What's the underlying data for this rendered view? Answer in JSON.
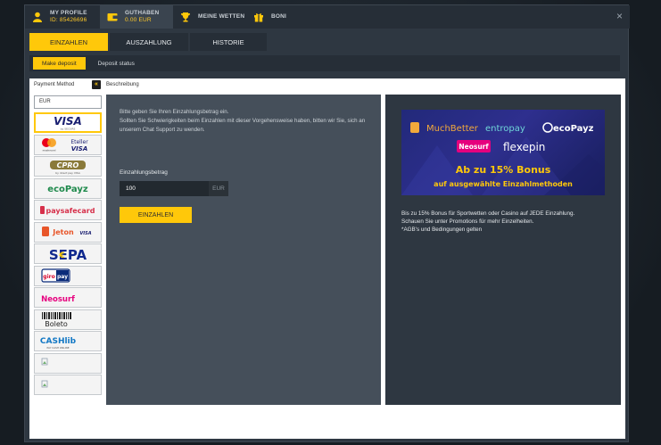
{
  "nav": {
    "profile": {
      "title": "MY PROFILE",
      "id": "ID: 85426696"
    },
    "balance": {
      "title": "GUTHABEN",
      "value": "0.00 EUR"
    },
    "bets": "MEINE WETTEN",
    "bonus": "BONI",
    "close": "×"
  },
  "tabs": [
    "EINZAHLEN",
    "AUSZAHLUNG",
    "HISTORIE"
  ],
  "subtabs": [
    "Make deposit",
    "Deposit status"
  ],
  "sidebar": {
    "payment_method_label": "Payment Method",
    "currency": "EUR",
    "methods": [
      {
        "name": "VISA",
        "sub": "by SECURE",
        "color": "#1a1f71"
      },
      {
        "name": "Eteller VISA",
        "sub": "mastercard",
        "color": "#1a1f71"
      },
      {
        "name": "CPRO",
        "sub": "by direct pay VISA",
        "color": "#7a6a2a"
      },
      {
        "name": "ecoPayz",
        "sub": "",
        "color": "#1f8a4c"
      },
      {
        "name": "paysafecard",
        "sub": "",
        "color": "#d6304a"
      },
      {
        "name": "Jeton",
        "sub": "VISA",
        "color": "#e8562a"
      },
      {
        "name": "SEPA",
        "sub": "",
        "color": "#10298e"
      },
      {
        "name": "giropay",
        "sub": "",
        "color": "#0a2b7a"
      },
      {
        "name": "Neosurf",
        "sub": "",
        "color": "#e6007e"
      },
      {
        "name": "Boleto",
        "sub": "",
        "color": "#222222"
      },
      {
        "name": "CASHlib",
        "sub": "PAY CASH ONLINE",
        "color": "#1177c4"
      },
      {
        "name": "",
        "sub": "",
        "color": ""
      },
      {
        "name": "",
        "sub": "",
        "color": ""
      }
    ]
  },
  "description_label": "Beschreibung",
  "form": {
    "intro_1": "Bitte geben Sie Ihren Einzahlungsbetrag ein.",
    "intro_2": "Sollten Sie Schwierigkeiten beim Einzahlen mit dieser Vorgehensweise haben, bitten wir Sie, sich an unserem Chat Support zu wenden.",
    "amount_label": "Einzahlungsbetrag",
    "amount_value": "100",
    "amount_currency": "EUR",
    "submit": "EINZAHLEN"
  },
  "promo": {
    "banner": {
      "brands": [
        "MuchBetter",
        "entropay",
        "ecoPayz",
        "Neosurf",
        "flexepin"
      ],
      "headline": "Ab zu 15% Bonus",
      "subline": "auf ausgewählte Einzahlmethoden"
    },
    "line1": "Bis zu 15% Bonus für Sportwetten oder Casino auf JEDE Einzahlung.",
    "line2": "Schauen Sie unter Promotions für mehr Einzelheiten.",
    "line3": "*AGB's und Bedingungen gelten"
  },
  "colors": {
    "accent": "#ffc80a",
    "panel": "#454f5a",
    "dark": "#2e3741"
  }
}
